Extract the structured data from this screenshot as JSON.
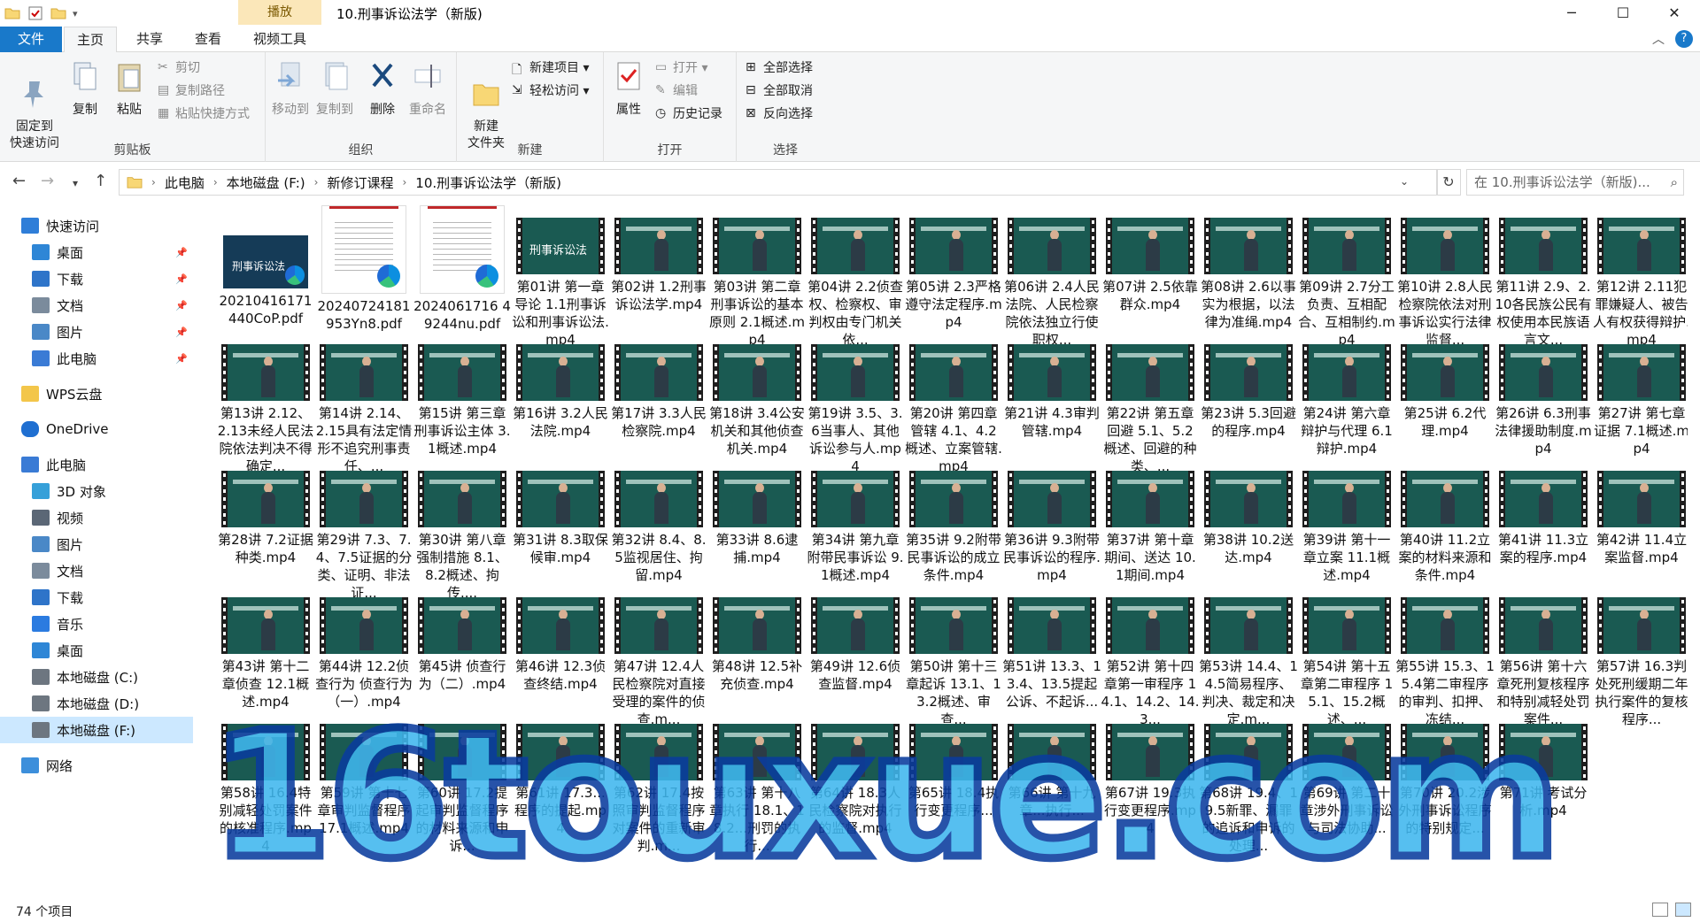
{
  "window": {
    "title": "10.刑事诉讼法学（新版)",
    "context_tab": "播放"
  },
  "tabs": [
    "文件",
    "主页",
    "共享",
    "查看",
    "视频工具"
  ],
  "ribbon": {
    "clipboard": {
      "label": "剪贴板",
      "pin": "固定到\n快速访问",
      "copy": "复制",
      "paste": "粘贴",
      "cut": "剪切",
      "copy_path": "复制路径",
      "paste_shortcut": "粘贴快捷方式"
    },
    "organize": {
      "label": "组织",
      "move_to": "移动到",
      "copy_to": "复制到",
      "delete": "删除",
      "rename": "重命名"
    },
    "new": {
      "label": "新建",
      "new_folder": "新建\n文件夹",
      "new_item": "新建项目 ▾",
      "easy_access": "轻松访问 ▾"
    },
    "open": {
      "label": "打开",
      "properties": "属性",
      "open": "打开 ▾",
      "edit": "编辑",
      "history": "历史记录"
    },
    "select": {
      "label": "选择",
      "select_all": "全部选择",
      "select_none": "全部取消",
      "invert": "反向选择"
    }
  },
  "address": {
    "crumbs": [
      "此电脑",
      "本地磁盘 (F:)",
      "新修订课程",
      "10.刑事诉讼法学（新版)"
    ],
    "search_placeholder": "在 10.刑事诉讼法学（新版)...  "
  },
  "nav": {
    "items": [
      {
        "label": "快速访问",
        "icon": "star-icon"
      },
      {
        "label": "桌面",
        "icon": "desktop-icon",
        "pinned": true
      },
      {
        "label": "下载",
        "icon": "download-icon",
        "pinned": true
      },
      {
        "label": "文档",
        "icon": "document-icon",
        "pinned": true
      },
      {
        "label": "图片",
        "icon": "picture-icon",
        "pinned": true
      },
      {
        "label": "此电脑",
        "icon": "computer-icon",
        "pinned": true
      },
      {
        "label": "WPS云盘",
        "icon": "folder-icon"
      },
      {
        "label": "OneDrive",
        "icon": "cloud-icon"
      },
      {
        "label": "此电脑",
        "icon": "computer-icon"
      },
      {
        "label": "3D 对象",
        "icon": "cube-icon"
      },
      {
        "label": "视频",
        "icon": "video-icon"
      },
      {
        "label": "图片",
        "icon": "picture-icon"
      },
      {
        "label": "文档",
        "icon": "document-icon"
      },
      {
        "label": "下载",
        "icon": "download-icon"
      },
      {
        "label": "音乐",
        "icon": "music-icon"
      },
      {
        "label": "桌面",
        "icon": "desktop-icon"
      },
      {
        "label": "本地磁盘 (C:)",
        "icon": "drive-icon"
      },
      {
        "label": "本地磁盘 (D:)",
        "icon": "drive-icon"
      },
      {
        "label": "本地磁盘 (F:)",
        "icon": "drive-icon",
        "selected": true
      },
      {
        "label": "网络",
        "icon": "network-icon"
      }
    ]
  },
  "files": [
    {
      "name": "20210416171440CoP.pdf",
      "type": "cover",
      "thumb_text": "刑事诉讼法"
    },
    {
      "name": "20240724181953Yn8.pdf",
      "type": "pdf"
    },
    {
      "name": "2024061716 49244nu.pdf",
      "type": "pdf"
    },
    {
      "name": "第01讲 第一章导论 1.1刑事诉讼和刑事诉讼法.mp4",
      "type": "video",
      "thumb_text": "刑事诉讼法"
    },
    {
      "name": "第02讲 1.2刑事诉讼法学.mp4",
      "type": "video"
    },
    {
      "name": "第03讲 第二章刑事诉讼的基本原则 2.1概述.mp4",
      "type": "video"
    },
    {
      "name": "第04讲 2.2侦查权、检察权、审判权由专门机关依...",
      "type": "video"
    },
    {
      "name": "第05讲 2.3严格遵守法定程序.mp4",
      "type": "video"
    },
    {
      "name": "第06讲 2.4人民法院、人民检察院依法独立行使职权...",
      "type": "video"
    },
    {
      "name": "第07讲 2.5依靠群众.mp4",
      "type": "video"
    },
    {
      "name": "第08讲 2.6以事实为根据，以法律为准绳.mp4",
      "type": "video"
    },
    {
      "name": "第09讲 2.7分工负责、互相配合、互相制约.mp4",
      "type": "video"
    },
    {
      "name": "第10讲 2.8人民检察院依法对刑事诉讼实行法律监督...",
      "type": "video"
    },
    {
      "name": "第11讲 2.9、2.10各民族公民有权使用本民族语言文...",
      "type": "video"
    },
    {
      "name": "第12讲 2.11犯罪嫌疑人、被告人有权获得辩护.mp4",
      "type": "video"
    },
    {
      "name": "第13讲 2.12、2.13未经人民法院依法判决不得确定...",
      "type": "video"
    },
    {
      "name": "第14讲 2.14、2.15具有法定情形不追究刑事责任、...",
      "type": "video"
    },
    {
      "name": "第15讲 第三章刑事诉讼主体 3.1概述.mp4",
      "type": "video"
    },
    {
      "name": "第16讲 3.2人民法院.mp4",
      "type": "video"
    },
    {
      "name": "第17讲 3.3人民检察院.mp4",
      "type": "video"
    },
    {
      "name": "第18讲 3.4公安机关和其他侦查机关.mp4",
      "type": "video"
    },
    {
      "name": "第19讲 3.5、3.6当事人、其他诉讼参与人.mp4",
      "type": "video"
    },
    {
      "name": "第20讲 第四章管辖 4.1、4.2概述、立案管辖.mp4",
      "type": "video"
    },
    {
      "name": "第21讲 4.3审判管辖.mp4",
      "type": "video"
    },
    {
      "name": "第22讲 第五章回避 5.1、5.2概述、回避的种类、...",
      "type": "video"
    },
    {
      "name": "第23讲 5.3回避的程序.mp4",
      "type": "video"
    },
    {
      "name": "第24讲 第六章辩护与代理 6.1辩护.mp4",
      "type": "video"
    },
    {
      "name": "第25讲 6.2代理.mp4",
      "type": "video"
    },
    {
      "name": "第26讲 6.3刑事法律援助制度.mp4",
      "type": "video"
    },
    {
      "name": "第27讲 第七章证据 7.1概述.mp4",
      "type": "video"
    },
    {
      "name": "第28讲 7.2证据种类.mp4",
      "type": "video"
    },
    {
      "name": "第29讲 7.3、7.4、7.5证据的分类、证明、非法证...",
      "type": "video"
    },
    {
      "name": "第30讲 第八章强制措施 8.1、8.2概述、拘传....",
      "type": "video"
    },
    {
      "name": "第31讲 8.3取保候审.mp4",
      "type": "video"
    },
    {
      "name": "第32讲 8.4、8.5监视居住、拘留.mp4",
      "type": "video"
    },
    {
      "name": "第33讲 8.6逮捕.mp4",
      "type": "video"
    },
    {
      "name": "第34讲 第九章附带民事诉讼 9.1概述.mp4",
      "type": "video"
    },
    {
      "name": "第35讲 9.2附带民事诉讼的成立条件.mp4",
      "type": "video"
    },
    {
      "name": "第36讲 9.3附带民事诉讼的程序.mp4",
      "type": "video"
    },
    {
      "name": "第37讲 第十章期间、送达 10.1期间.mp4",
      "type": "video"
    },
    {
      "name": "第38讲 10.2送达.mp4",
      "type": "video"
    },
    {
      "name": "第39讲 第十一章立案 11.1概述.mp4",
      "type": "video"
    },
    {
      "name": "第40讲 11.2立案的材料来源和条件.mp4",
      "type": "video"
    },
    {
      "name": "第41讲 11.3立案的程序.mp4",
      "type": "video"
    },
    {
      "name": "第42讲 11.4立案监督.mp4",
      "type": "video"
    },
    {
      "name": "第43讲 第十二章侦查 12.1概述.mp4",
      "type": "video"
    },
    {
      "name": "第44讲 12.2侦查行为 侦查行为（一）.mp4",
      "type": "video"
    },
    {
      "name": "第45讲 侦查行为（二）.mp4",
      "type": "video"
    },
    {
      "name": "第46讲 12.3侦查终结.mp4",
      "type": "video"
    },
    {
      "name": "第47讲 12.4人民检察院对直接受理的案件的侦查.m...",
      "type": "video"
    },
    {
      "name": "第48讲 12.5补充侦查.mp4",
      "type": "video"
    },
    {
      "name": "第49讲 12.6侦查监督.mp4",
      "type": "video"
    },
    {
      "name": "第50讲 第十三章起诉 13.1、13.2概述、审查...",
      "type": "video"
    },
    {
      "name": "第51讲 13.3、13.4、13.5提起公诉、不起诉...",
      "type": "video"
    },
    {
      "name": "第52讲 第十四章第一审程序 14.1、14.2、14.3...",
      "type": "video"
    },
    {
      "name": "第53讲 14.4、14.5简易程序、判决、裁定和决定.m...",
      "type": "video"
    },
    {
      "name": "第54讲 第十五章第二审程序 15.1、15.2概述、...",
      "type": "video"
    },
    {
      "name": "第55讲 15.3、15.4第二审程序的审判、扣押、冻结...",
      "type": "video"
    },
    {
      "name": "第56讲 第十六章死刑复核程序和特别减轻处罚案件...",
      "type": "video"
    },
    {
      "name": "第57讲 16.3判处死刑缓期二年执行案件的复核程序...",
      "type": "video"
    },
    {
      "name": "第58讲 16.4特别减轻处罚案件的核准程序.mp4",
      "type": "video"
    },
    {
      "name": "第59讲 第十七章审判监督程序 17.1概述.mp4",
      "type": "video"
    },
    {
      "name": "第60讲 17.2提起审判监督程序的材料来源和申诉...",
      "type": "video"
    },
    {
      "name": "第61讲 17.3...程序的提起.mp4",
      "type": "video"
    },
    {
      "name": "第62讲 17.4按照审判监督程序对案件的重新审判.m...",
      "type": "video"
    },
    {
      "name": "第63讲 第十八章执行 18.1、18.2...刑罚的执行...",
      "type": "video"
    },
    {
      "name": "第64讲 18.3人民检察院对执行的监督.mp4",
      "type": "video"
    },
    {
      "name": "第65讲 18.4执行变更程序...",
      "type": "video"
    },
    {
      "name": "第66讲 第十九章...执行...",
      "type": "video"
    },
    {
      "name": "第67讲 19.3执行变更程序.mp4",
      "type": "video"
    },
    {
      "name": "第68讲 19.4、19.5新罪、漏罪的追诉和申诉的处理...",
      "type": "video"
    },
    {
      "name": "第69讲 第二十章涉外刑事诉讼与司法协助...",
      "type": "video"
    },
    {
      "name": "第70讲 20.2涉外刑事诉讼程序的特别规定...",
      "type": "video"
    },
    {
      "name": "第71讲 考试分析.mp4",
      "type": "video"
    }
  ],
  "status": {
    "count": "74 个项目"
  },
  "watermark": "16touxue.com"
}
